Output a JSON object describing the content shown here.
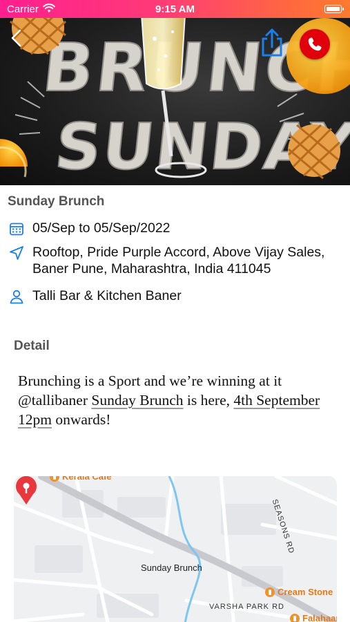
{
  "status_bar": {
    "carrier": "Carrier",
    "time": "9:15 AM"
  },
  "hero": {
    "image_lines": [
      "BRUNCH",
      "SUNDAYS"
    ]
  },
  "event": {
    "title": "Sunday Brunch",
    "date_range": "05/Sep to 05/Sep/2022",
    "address": "Rooftop, Pride Purple Accord, Above Vijay Sales, Baner Pune, Maharashtra, India 411045",
    "host": "Talli Bar & Kitchen Baner"
  },
  "detail": {
    "heading": "Detail",
    "text_before": "Brunching is a Sport and we’re winning at it @tallibaner ",
    "link_text": "Sunday Brunch",
    "text_middle": " is here, ",
    "date_link": "4th September 12pm",
    "text_after": " onwards!"
  },
  "map": {
    "pin_label": "Sunday Brunch",
    "streets": [
      "SEASONS RD",
      "VARSHA PARK RD"
    ],
    "pois": [
      "Kerala Cafe",
      "Cream Stone",
      "Falahaar"
    ]
  },
  "colors": {
    "status_gradient_start": "#ff1f8e",
    "status_gradient_end": "#ff7a2e",
    "accent_blue": "#1a7fe8",
    "call_red": "#e0000b",
    "pin_red": "#e8383d",
    "poi_orange": "#f2902a"
  },
  "icons": {
    "back": "chevron-left-icon",
    "share": "share-icon",
    "call": "phone-icon",
    "date": "calendar-icon",
    "address": "location-arrow-icon",
    "host": "person-icon"
  }
}
